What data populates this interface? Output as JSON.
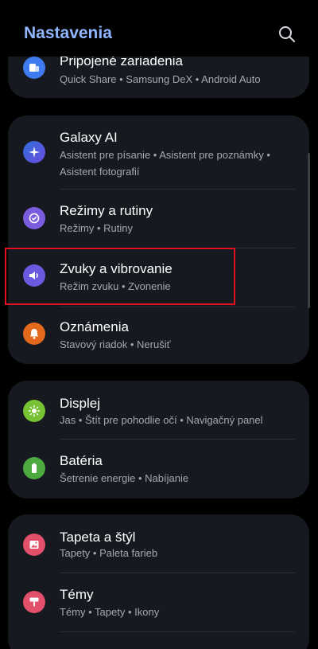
{
  "header": {
    "title": "Nastavenia",
    "search_icon": "search-icon"
  },
  "groups": [
    {
      "items": [
        {
          "label": "Pripojené zariadenia",
          "sub": "Quick Share  •  Samsung DeX  •  Android Auto",
          "icon": "connected-devices-icon",
          "color": "#3f7bf0"
        }
      ]
    },
    {
      "items": [
        {
          "label": "Galaxy AI",
          "sub": "Asistent pre písanie  •  Asistent pre poznámky  •  Asistent fotografií",
          "icon": "galaxy-ai-icon",
          "color": "#2e7bd9"
        },
        {
          "label": "Režimy a rutiny",
          "sub": "Režimy  •  Rutiny",
          "icon": "modes-routines-icon",
          "color": "#7b5cdf"
        },
        {
          "label": "Zvuky a vibrovanie",
          "sub": "Režim zvuku  •  Zvonenie",
          "icon": "sound-icon",
          "color": "#6b5ae0"
        },
        {
          "label": "Oznámenia",
          "sub": "Stavový riadok  •  Nerušiť",
          "icon": "notifications-bell-icon",
          "color": "#e4691c"
        }
      ]
    },
    {
      "items": [
        {
          "label": "Displej",
          "sub": "Jas  •  Štít pre pohodlie očí  •  Navigačný panel",
          "icon": "display-sun-icon",
          "color": "#76c233"
        },
        {
          "label": "Batéria",
          "sub": "Šetrenie energie  •  Nabíjanie",
          "icon": "battery-icon",
          "color": "#4caa3f"
        }
      ]
    },
    {
      "items": [
        {
          "label": "Tapeta a štýl",
          "sub": "Tapety  •  Paleta farieb",
          "icon": "wallpaper-icon",
          "color": "#e2506b"
        },
        {
          "label": "Témy",
          "sub": "Témy  •  Tapety  •  Ikony",
          "icon": "themes-brush-icon",
          "color": "#e2506b"
        }
      ]
    }
  ]
}
